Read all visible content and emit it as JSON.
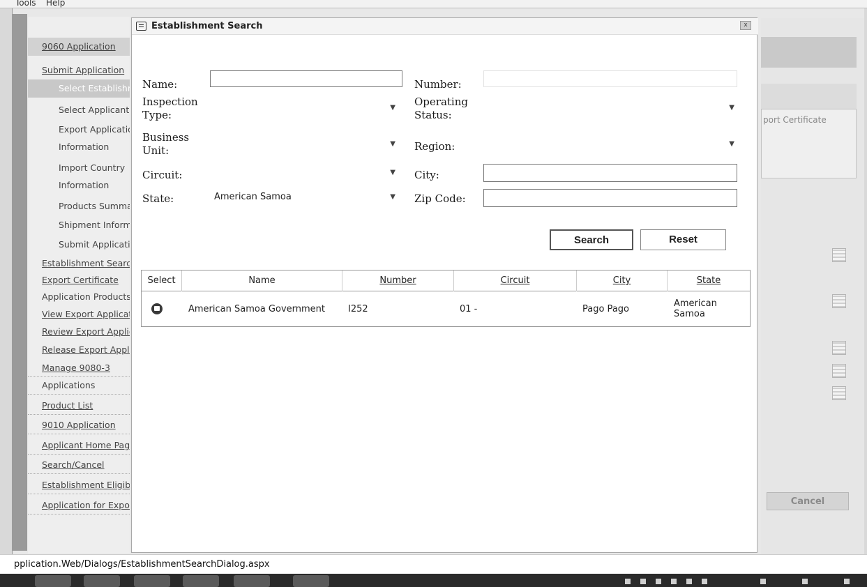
{
  "menubar": {
    "tools": "Tools",
    "help": "Help"
  },
  "sidebar": {
    "items": [
      {
        "label": "9060 Application",
        "level": "l1"
      },
      {
        "label": "Submit Application",
        "level": "l1"
      },
      {
        "label": "Select Establishment",
        "level": "l2"
      },
      {
        "label": "Select Applicant",
        "level": "l2"
      },
      {
        "label": "Export Application",
        "level": "l2"
      },
      {
        "label": "Information",
        "level": "l2"
      },
      {
        "label": "Import Country",
        "level": "l2"
      },
      {
        "label": "Information",
        "level": "l2"
      },
      {
        "label": "Products Summary",
        "level": "l2"
      },
      {
        "label": "Shipment Information",
        "level": "l2"
      },
      {
        "label": "Submit Application",
        "level": "l2"
      },
      {
        "label": "Establishment Search",
        "level": "l1"
      },
      {
        "label": "Export Certificate",
        "level": "l1"
      },
      {
        "label": "Application Products",
        "level": "l1"
      },
      {
        "label": "View Export Application",
        "level": "l1"
      },
      {
        "label": "Review Export Application",
        "level": "l1"
      },
      {
        "label": "Release Export Application",
        "level": "l1"
      },
      {
        "label": "Manage 9080-3",
        "level": "l0"
      },
      {
        "label": "Applications",
        "level": "l0"
      },
      {
        "label": "Product List",
        "level": "l0"
      },
      {
        "label": "9010 Application",
        "level": "l0"
      },
      {
        "label": "Applicant Home Page",
        "level": "l0"
      },
      {
        "label": "Search/Cancel",
        "level": "l0"
      },
      {
        "label": "Establishment Eligibility",
        "level": "l0"
      },
      {
        "label": "Application for Export",
        "level": "l0"
      }
    ]
  },
  "right_panel": {
    "text": "port Certificate",
    "cancel": "Cancel"
  },
  "dialog": {
    "title": "Establishment Search",
    "close": "x",
    "labels": {
      "name": "Name:",
      "number": "Number:",
      "inspection_type_1": "Inspection",
      "inspection_type_2": "Type:",
      "operating_status_1": "Operating",
      "operating_status_2": "Status:",
      "business_unit_1": "Business",
      "business_unit_2": "Unit:",
      "region": "Region:",
      "circuit": "Circuit:",
      "city": "City:",
      "state": "State:",
      "zip": "Zip Code:"
    },
    "state_value": "American Samoa",
    "buttons": {
      "search": "Search",
      "reset": "Reset"
    },
    "grid": {
      "headers": [
        "Select",
        "Name",
        "Number",
        "Circuit",
        "City",
        "State"
      ],
      "rows": [
        {
          "name": "American Samoa Government",
          "number": "I252",
          "circuit": "01 -",
          "city": "Pago Pago",
          "state_1": "American",
          "state_2": "Samoa"
        }
      ]
    }
  },
  "statusbar": {
    "url": "pplication.Web/Dialogs/EstablishmentSearchDialog.aspx"
  }
}
